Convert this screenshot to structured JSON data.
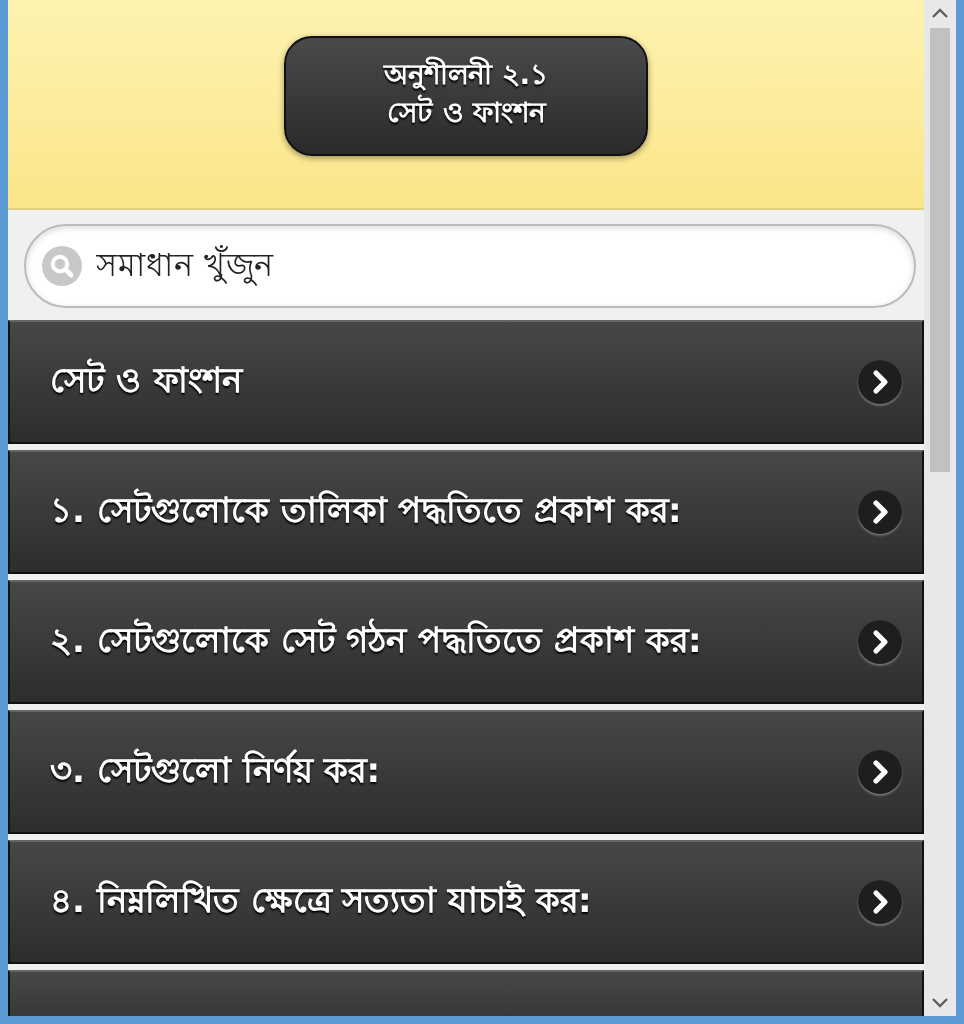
{
  "header": {
    "title_lines": [
      "অনুশীলনী ২.১",
      "সেট ও ফাংশন"
    ]
  },
  "search": {
    "placeholder": "সমাধান খুঁজুন"
  },
  "items": [
    {
      "label": "সেট ও ফাংশন"
    },
    {
      "label": "১. সেটগুলোকে তালিকা পদ্ধতিতে প্রকাশ কর:"
    },
    {
      "label": "২. সেটগুলোকে সেট গঠন পদ্ধতিতে প্রকাশ কর:"
    },
    {
      "label": "৩. সেটগুলো নির্ণয় কর:"
    },
    {
      "label": "৪. নিম্নলিখিত ক্ষেত্রে সত্যতা যাচাই কর:"
    }
  ]
}
